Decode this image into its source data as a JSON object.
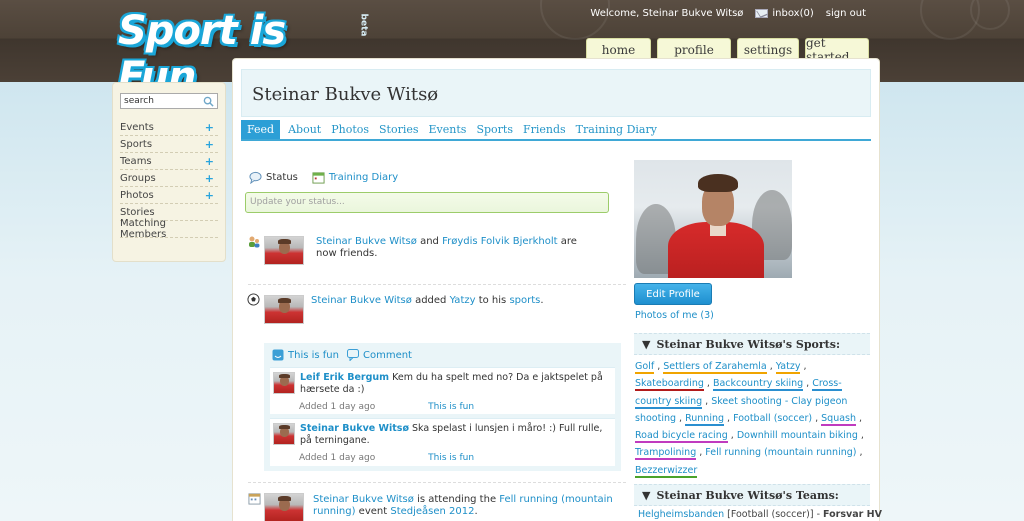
{
  "header": {
    "logo": "Sport is Fun",
    "logo_badge": "beta",
    "welcome": "Welcome, Steinar Bukve Witsø",
    "inbox": "inbox(0)",
    "signout": "sign out",
    "nav": [
      "home",
      "profile",
      "settings",
      "get started"
    ]
  },
  "sidebar": {
    "search_placeholder": "search",
    "items": [
      {
        "label": "Events",
        "plus": "+"
      },
      {
        "label": "Sports",
        "plus": "+"
      },
      {
        "label": "Teams",
        "plus": "+"
      },
      {
        "label": "Groups",
        "plus": "+"
      },
      {
        "label": "Photos",
        "plus": "+"
      },
      {
        "label": "Stories",
        "plus": ""
      },
      {
        "label": "Matching Members",
        "plus": ""
      }
    ]
  },
  "profile": {
    "name": "Steinar Bukve Witsø",
    "tabs": [
      "Feed",
      "About",
      "Photos",
      "Stories",
      "Events",
      "Sports",
      "Friends",
      "Training Diary"
    ],
    "active_tab": "Feed"
  },
  "status": {
    "status_label": "Status",
    "diary_label": "Training Diary",
    "placeholder": "Update your status..."
  },
  "feed": {
    "item1": {
      "actor": "Steinar Bukve Witsø",
      "and": " and ",
      "friend": "Frøydis Folvik Bjerkholt",
      "tail": " are now friends."
    },
    "item2": {
      "actor": "Steinar Bukve Witsø",
      "mid": " added ",
      "sport": "Yatzy",
      "mid2": " to his ",
      "sports": "sports",
      "end": "."
    },
    "comment_bar": {
      "fun": "This is fun",
      "comment": "Comment"
    },
    "comments": [
      {
        "author": "Leif Erik Bergum",
        "text": " Kem du ha spelt med no? Da e jaktspelet på hærsete da :)",
        "time": "Added 1 day ago",
        "fun": "This is fun"
      },
      {
        "author": "Steinar Bukve Witsø",
        "text": " Ska spelast i lunsjen i måro! :) Full rulle, på terningane.",
        "time": "Added 1 day ago",
        "fun": "This is fun"
      }
    ],
    "item3": {
      "actor": "Steinar Bukve Witsø",
      "mid": " is attending the ",
      "event": "Fell running (mountain running)",
      "mid2": " event ",
      "place": "Stedjeåsen 2012",
      "end": "."
    }
  },
  "right": {
    "edit_profile": "Edit Profile",
    "photos_of_me": "Photos of me (3)",
    "sports_heading": "Steinar Bukve Witsø's Sports:",
    "teams_heading": "Steinar Bukve Witsø's Teams:",
    "sports": [
      {
        "name": "Golf",
        "color": "#f0a400"
      },
      {
        "name": "Settlers of Zarahemla",
        "color": "#f0a400"
      },
      {
        "name": "Yatzy",
        "color": "#f0a400"
      },
      {
        "name": "Skateboarding",
        "color": "#b21b1b"
      },
      {
        "name": "Backcountry skiing",
        "color": "#2a8fd0"
      },
      {
        "name": "Cross-country skiing",
        "color": "#2a8fd0"
      },
      {
        "name": "Skeet shooting - Clay pigeon shooting",
        "color": ""
      },
      {
        "name": "Running",
        "color": "#2a8fd0"
      },
      {
        "name": "Football (soccer)",
        "color": ""
      },
      {
        "name": "Squash",
        "color": "#c03bbf"
      },
      {
        "name": "Road bicycle racing",
        "color": "#c03bbf"
      },
      {
        "name": "Downhill mountain biking",
        "color": ""
      },
      {
        "name": "Trampolining",
        "color": "#c03bbf"
      },
      {
        "name": "Fell running (mountain running)",
        "color": ""
      },
      {
        "name": "Bezzerwizzer",
        "color": "#4aa32a"
      }
    ],
    "team": {
      "name": "Helgheimsbanden",
      "sport": " [Football (soccer)] - ",
      "org": "Forsvar HV"
    }
  }
}
